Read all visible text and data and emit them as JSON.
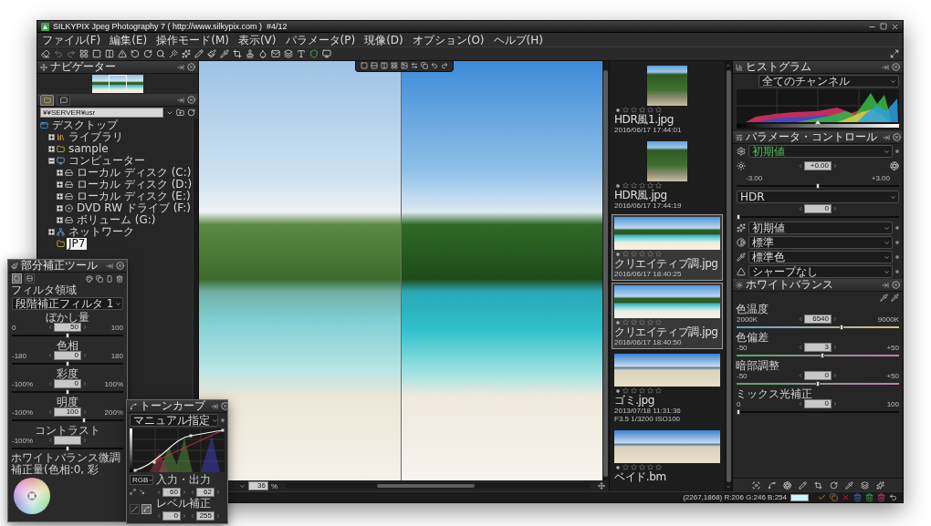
{
  "window": {
    "title": "SILKYPIX Jpeg Photography 7 ( http://www.silkypix.com )  #4/12"
  },
  "menu": [
    "ファイル(F)",
    "編集(E)",
    "操作モード(M)",
    "表示(V)",
    "パラメータ(P)",
    "現像(D)",
    "オプション(O)",
    "ヘルプ(H)"
  ],
  "navigator": {
    "title": "ナビゲーター"
  },
  "folder_panel": {
    "tabs": [
      {
        "kind": "folders",
        "selected": true
      },
      {
        "kind": "comments",
        "selected": false
      }
    ],
    "path": "¥¥SERVER¥usr",
    "tree": [
      {
        "label": "デスクトップ",
        "kind": "desktop",
        "selected": false,
        "children": [
          {
            "label": "ライブラリ",
            "kind": "library",
            "expanded": false,
            "selected": false
          },
          {
            "label": "sample",
            "kind": "folder",
            "expanded": false,
            "selected": false
          },
          {
            "label": "コンピューター",
            "kind": "computer",
            "expanded": true,
            "selected": false,
            "children": [
              {
                "label": "ローカル ディスク (C:)",
                "kind": "disk",
                "expanded": false,
                "selected": false
              },
              {
                "label": "ローカル ディスク (D:)",
                "kind": "disk",
                "expanded": false,
                "selected": false
              },
              {
                "label": "ローカル ディスク (E:)",
                "kind": "disk",
                "expanded": false,
                "selected": false
              },
              {
                "label": "DVD RW ドライブ (F:)",
                "kind": "dvd",
                "expanded": false,
                "selected": false
              },
              {
                "label": "ボリューム (G:)",
                "kind": "disk",
                "expanded": false,
                "selected": false
              }
            ]
          },
          {
            "label": "ネットワーク",
            "kind": "network",
            "expanded": false,
            "selected": false
          },
          {
            "label": "JP7",
            "kind": "folder",
            "selected": true
          }
        ]
      }
    ]
  },
  "preview": {
    "zoom": "36",
    "zoom_unit": "%"
  },
  "filmstrip": [
    {
      "kind": "forest",
      "stars": 0,
      "name": "HDR風1.jpg",
      "date": "2016/06/17 17:44:01",
      "selected": false
    },
    {
      "kind": "forest",
      "stars": 0,
      "name": "HDR風.jpg",
      "date": "2016/06/17 17:44:19",
      "selected": false
    },
    {
      "kind": "island",
      "stars": 0,
      "name": "クリエイティブ調.jpg",
      "date": "2016/06/17 18:40:25",
      "selected": true
    },
    {
      "kind": "island",
      "stars": 0,
      "name": "クリエイティブ調.jpg",
      "date": "2016/06/17 18:40:50",
      "selected": true
    },
    {
      "kind": "shore",
      "stars": 0,
      "name": "ゴミ.jpg",
      "date": "2013/07/18 11:31:36",
      "exif": "F3.5 1/3200 ISO100",
      "selected": false
    },
    {
      "kind": "shore",
      "stars": 0,
      "name": "ベイド.bm",
      "selected": false
    }
  ],
  "histogram": {
    "title": "ヒストグラム",
    "channel": "全てのチャンネル"
  },
  "parameter_control": {
    "title": "パラメータ・コントロール",
    "taste": "初期値",
    "exposure": {
      "value": "+0.00",
      "min": "-3.00",
      "max": "+3.00",
      "level": 0.5
    },
    "hdr": {
      "mode": "HDR",
      "value": "0",
      "level": 0
    },
    "settings": [
      {
        "kind": "tone",
        "value": "初期値"
      },
      {
        "kind": "contrast",
        "value": "標準"
      },
      {
        "kind": "color",
        "value": "標準色"
      },
      {
        "kind": "sharpness",
        "value": "シャープなし"
      }
    ]
  },
  "white_balance": {
    "title": "ホワイトバランス",
    "sliders": [
      {
        "label": "色温度",
        "min": "2000K",
        "value": "6540",
        "max": "9000K",
        "level": 0.65,
        "kind": "warmth"
      },
      {
        "label": "色偏差",
        "min": "-50",
        "value": "3",
        "max": "+50",
        "level": 0.53,
        "kind": "tint"
      },
      {
        "label": "暗部調整",
        "min": "-50",
        "value": "0",
        "max": "+50",
        "level": 0.5,
        "kind": "tint"
      },
      {
        "label": "ミックス光補正",
        "min": "0",
        "value": "0",
        "max": "100",
        "level": 0,
        "kind": "plain"
      }
    ]
  },
  "status_bar": {
    "text": "(2267,1868) R:206 G:246 B:254",
    "color": "#cef6fe"
  },
  "partial_tool": {
    "title": "部分補正ツール",
    "modes": [
      {
        "kind": "single",
        "selected": true
      },
      {
        "kind": "split",
        "selected": false
      }
    ],
    "filter_label": "フィルタ領域",
    "filter": "段階補正フィルタ 1",
    "sliders": [
      {
        "label": "ぼかし量",
        "min": "0",
        "value": "50",
        "max": "100",
        "level": 0.5
      },
      {
        "label": "色相",
        "min": "-180",
        "value": "0",
        "max": "180",
        "level": 0.5
      },
      {
        "label": "彩度",
        "min": "-100%",
        "value": "0",
        "max": "100%",
        "level": 0.5
      },
      {
        "label": "明度",
        "min": "-100%",
        "value": "100",
        "max": "200%",
        "level": 0.65
      },
      {
        "label": "コントラスト",
        "min": "-100%",
        "level": 0.5
      }
    ],
    "notes": [
      "ホワイトバランス微調",
      "補正量(色相:0, 彩"
    ]
  },
  "tone_curve": {
    "title": "トーンカーブ",
    "mode": "マニュアル指定",
    "channel": "RGB",
    "io_label": "入力・出力",
    "input": "60",
    "output": "62",
    "levels_label": "レベル補正",
    "black_point": "0",
    "white_point": "255",
    "curve_modes": [
      {
        "kind": "line",
        "selected": false
      },
      {
        "kind": "curve",
        "selected": true
      }
    ]
  }
}
